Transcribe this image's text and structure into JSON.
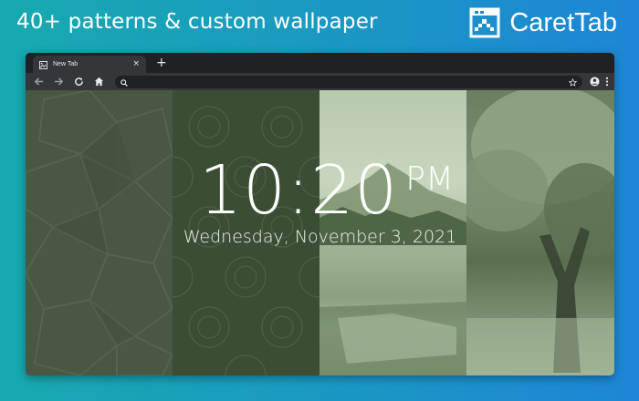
{
  "promo": {
    "headline": "40+ patterns & custom wallpaper",
    "brand_name": "CaretTab",
    "logo_icon": "carettab-logo-icon"
  },
  "browser": {
    "tab": {
      "title": "New Tab",
      "favicon": "image-icon",
      "close": "×"
    },
    "new_tab_label": "+",
    "toolbar_icons": [
      "back-arrow-icon",
      "forward-arrow-icon",
      "reload-icon",
      "home-icon",
      "search-icon",
      "star-icon",
      "account-icon",
      "menu-icon"
    ],
    "omnibox_placeholder": ""
  },
  "new_tab_page": {
    "time": "10:20",
    "ampm": "PM",
    "date": "Wednesday, November 3, 2021",
    "wallpapers": [
      "geometric-pattern",
      "mandala-pattern",
      "lake-mountain-photo",
      "tree-photo"
    ],
    "tint_color": "#4e6a45"
  }
}
